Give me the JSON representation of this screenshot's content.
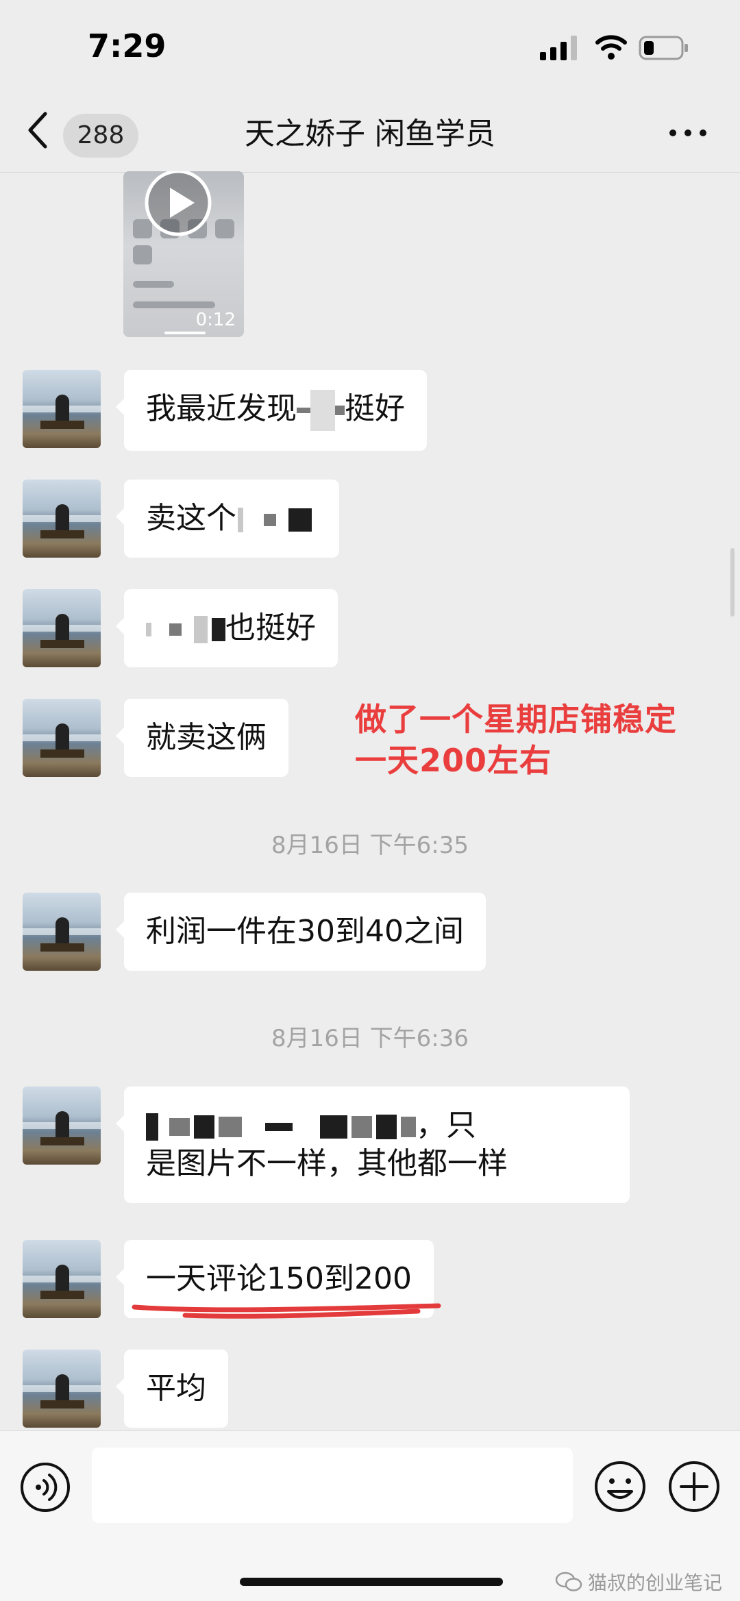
{
  "status_bar": {
    "time": "7:29",
    "icons": [
      "signal-icon",
      "wifi-icon",
      "battery-icon"
    ]
  },
  "nav": {
    "unread_count": "288",
    "title": "天之娇子 闲鱼学员",
    "icons": [
      "back-icon",
      "more-icon"
    ]
  },
  "video_message": {
    "duration": "0:12",
    "icon": "play-icon"
  },
  "messages": [
    {
      "text_before": "我最近发现",
      "text_after": "挺好"
    },
    {
      "text_before": "卖这个",
      "text_after": ""
    },
    {
      "text_before": "",
      "text_after": "也挺好"
    },
    {
      "text_before": "就卖这俩",
      "text_after": ""
    }
  ],
  "annotation": {
    "line1": "做了一个星期店铺稳定",
    "line2": "一天200左右",
    "color": "#ea3e3e"
  },
  "timestamps": [
    "8月16日 下午6:35",
    "8月16日 下午6:36"
  ],
  "messages_later": {
    "profit": "利润一件在30到40之间",
    "images_line1_tail": "，只",
    "images_line2": "是图片不一样，其他都一样",
    "comments": "一天评论150到200",
    "average": "平均"
  },
  "input_bar": {
    "icons": [
      "voice-icon",
      "emoji-icon",
      "plus-icon"
    ]
  },
  "watermark": "猫叔的创业笔记",
  "colors": {
    "background": "#ededed",
    "bubble": "#ffffff",
    "timestamp": "#a3a3a3",
    "annotation_red": "#ea3e3e"
  }
}
